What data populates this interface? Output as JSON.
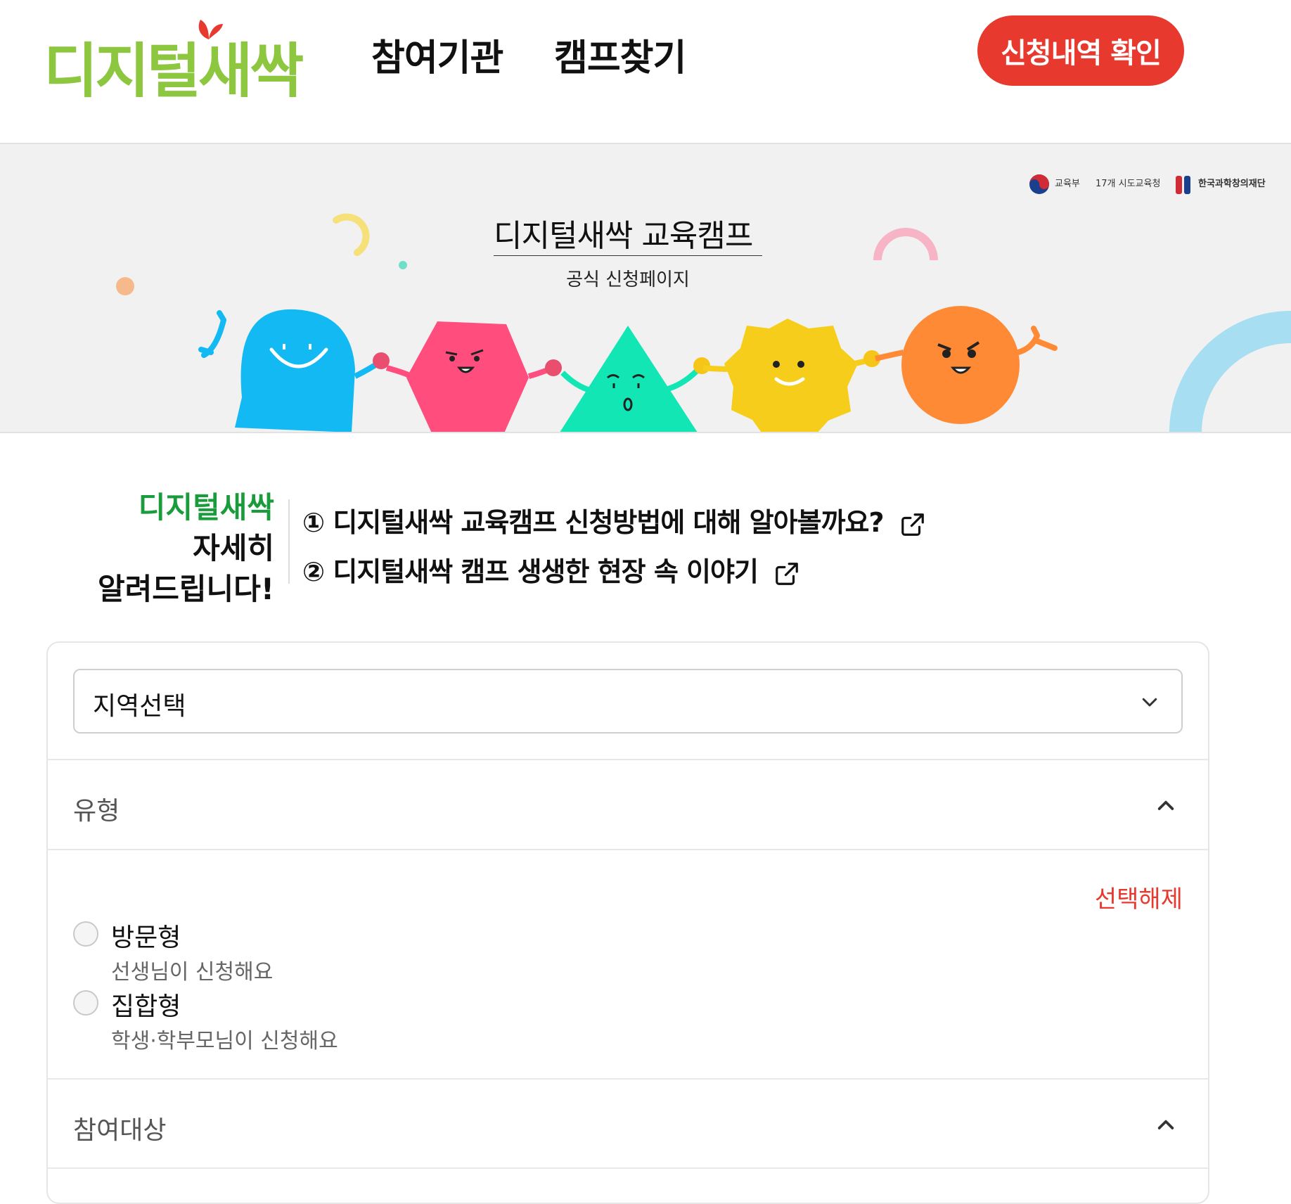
{
  "header": {
    "logo_text": "디지털새싹",
    "nav": [
      "참여기관",
      "캠프찾기"
    ],
    "apply_check_label": "신청내역 확인"
  },
  "banner": {
    "title": "디지털새싹 교육캠프",
    "subtitle": "공식 신청페이지",
    "sponsors": [
      "교육부",
      "17개 시도교육청",
      "한국과학창의재단"
    ]
  },
  "intro": {
    "green": "디지털새싹",
    "line2": "자세히",
    "line3": "알려드립니다!",
    "links": [
      "① 디지털새싹 교육캠프 신청방법에 대해 알아볼까요?",
      "② 디지털새싹 캠프 생생한 현장 속 이야기"
    ]
  },
  "filter": {
    "region_placeholder": "지역선택",
    "type_section": "유형",
    "reset_label": "선택해제",
    "options": [
      {
        "label": "방문형",
        "desc": "선생님이 신청해요"
      },
      {
        "label": "집합형",
        "desc": "학생·학부모님이 신청해요"
      }
    ],
    "target_section": "참여대상"
  },
  "colors": {
    "brand_green": "#8dc63f",
    "accent_red": "#e8392f",
    "intro_green": "#1b9c3c"
  }
}
